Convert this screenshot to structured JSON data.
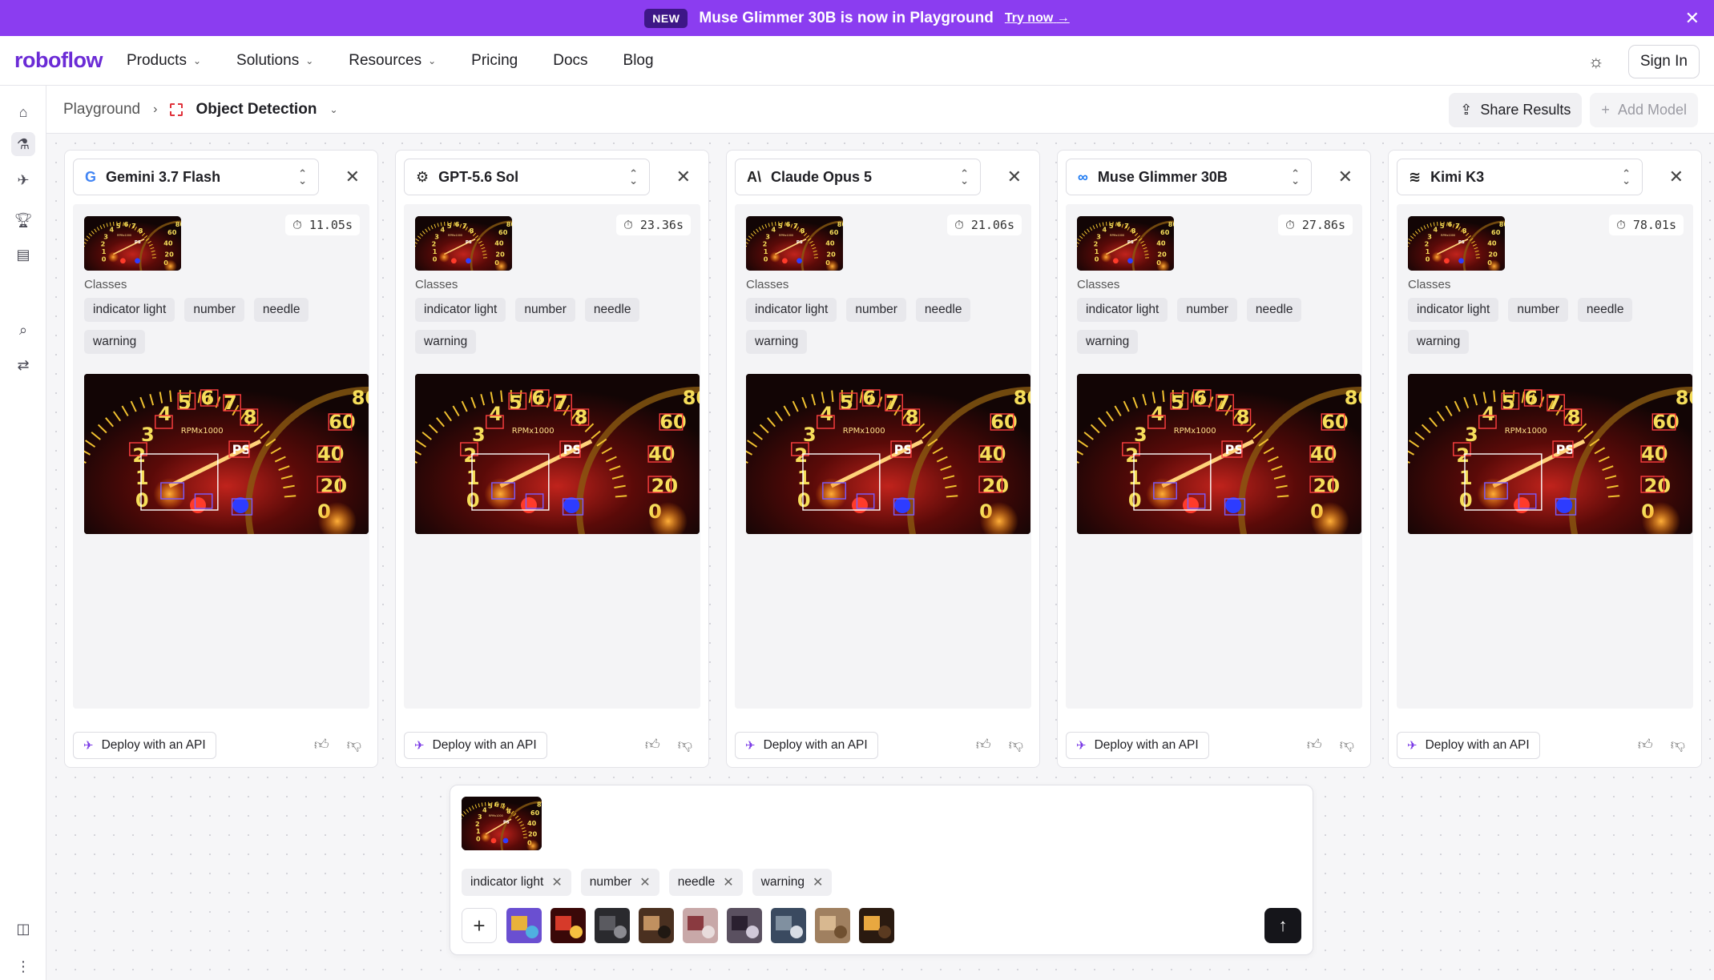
{
  "banner": {
    "badge": "NEW",
    "message": "Muse Glimmer 30B is now in Playground",
    "link": "Try now"
  },
  "nav": {
    "logo": "roboflow",
    "items": [
      "Products",
      "Solutions",
      "Resources",
      "Pricing",
      "Docs",
      "Blog"
    ],
    "sign_in": "Sign In"
  },
  "breadcrumb": {
    "root": "Playground",
    "current": "Object Detection"
  },
  "actions": {
    "share": "Share Results",
    "add_model": "Add Model"
  },
  "classes_label": "Classes",
  "deploy_label": "Deploy with an API",
  "models": [
    {
      "name": "Gemini 3.7 Flash",
      "time": "11.05s",
      "icon": "google-icon",
      "classes": [
        "indicator light",
        "number",
        "needle",
        "warning"
      ]
    },
    {
      "name": "GPT-5.6 Sol",
      "time": "23.36s",
      "icon": "openai-icon",
      "classes": [
        "indicator light",
        "number",
        "needle",
        "warning"
      ]
    },
    {
      "name": "Claude Opus 5",
      "time": "21.06s",
      "icon": "anthropic-icon",
      "classes": [
        "indicator light",
        "number",
        "needle",
        "warning"
      ]
    },
    {
      "name": "Muse Glimmer 30B",
      "time": "27.86s",
      "icon": "meta-icon",
      "classes": [
        "indicator light",
        "number",
        "needle",
        "warning"
      ]
    },
    {
      "name": "Kimi K3",
      "time": "78.01s",
      "icon": "kimi-icon",
      "classes": [
        "indicator light",
        "number",
        "needle",
        "warning"
      ]
    }
  ],
  "composer": {
    "classes": [
      "indicator light",
      "number",
      "needle",
      "warning"
    ]
  }
}
